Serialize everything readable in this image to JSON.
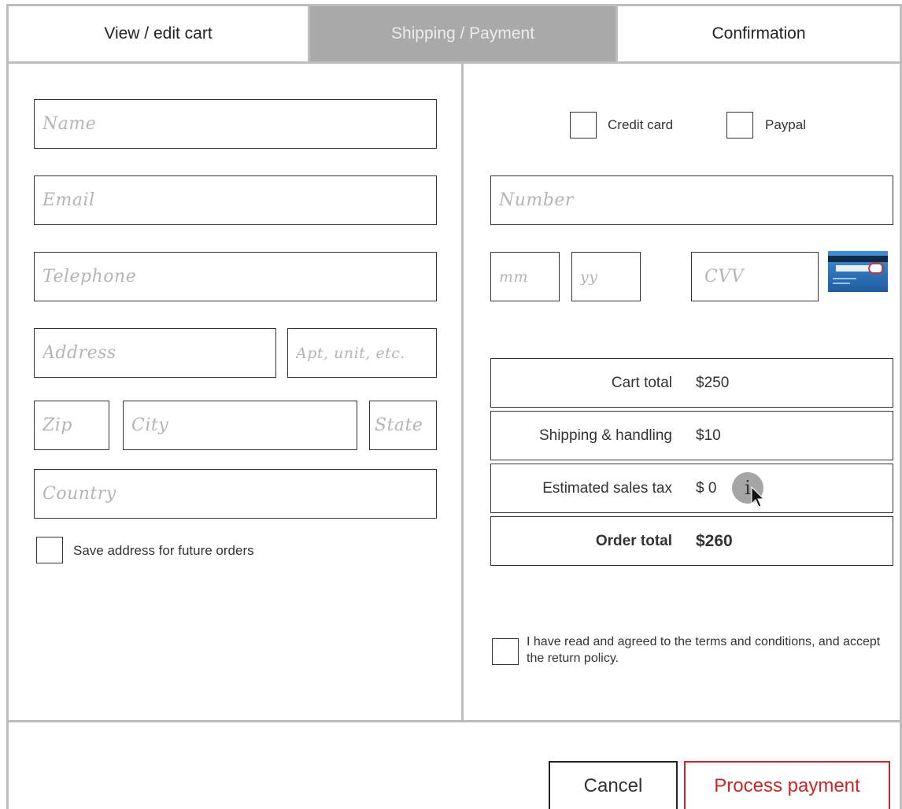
{
  "tabs": [
    {
      "label": "View / edit cart",
      "active": false
    },
    {
      "label": "Shipping / Payment",
      "active": true
    },
    {
      "label": "Confirmation",
      "active": false
    }
  ],
  "shipping": {
    "name_placeholder": "Name",
    "email_placeholder": "Email",
    "telephone_placeholder": "Telephone",
    "address_placeholder": "Address",
    "apt_placeholder": "Apt, unit, etc.",
    "zip_placeholder": "Zip",
    "city_placeholder": "City",
    "state_placeholder": "State",
    "country_placeholder": "Country",
    "save_address_label": "Save address for future orders"
  },
  "payment": {
    "credit_card_label": "Credit card",
    "paypal_label": "Paypal",
    "number_placeholder": "Number",
    "mm_placeholder": "mm",
    "yy_placeholder": "yy",
    "cvv_placeholder": "CVV"
  },
  "summary": {
    "cart_total_label": "Cart total",
    "cart_total_value": "$250",
    "shipping_label": "Shipping & handling",
    "shipping_value": "$10",
    "tax_label": "Estimated sales tax",
    "tax_value": "$ 0",
    "info_glyph": "i",
    "order_total_label": "Order total",
    "order_total_value": "$260"
  },
  "terms_label": "I have read and agreed to the terms and conditions, and accept the return policy.",
  "buttons": {
    "cancel": "Cancel",
    "process": "Process payment"
  },
  "colors": {
    "active_tab_bg": "#a9a9a9",
    "process_accent": "#c62828",
    "divider": "#bdbdbd"
  }
}
